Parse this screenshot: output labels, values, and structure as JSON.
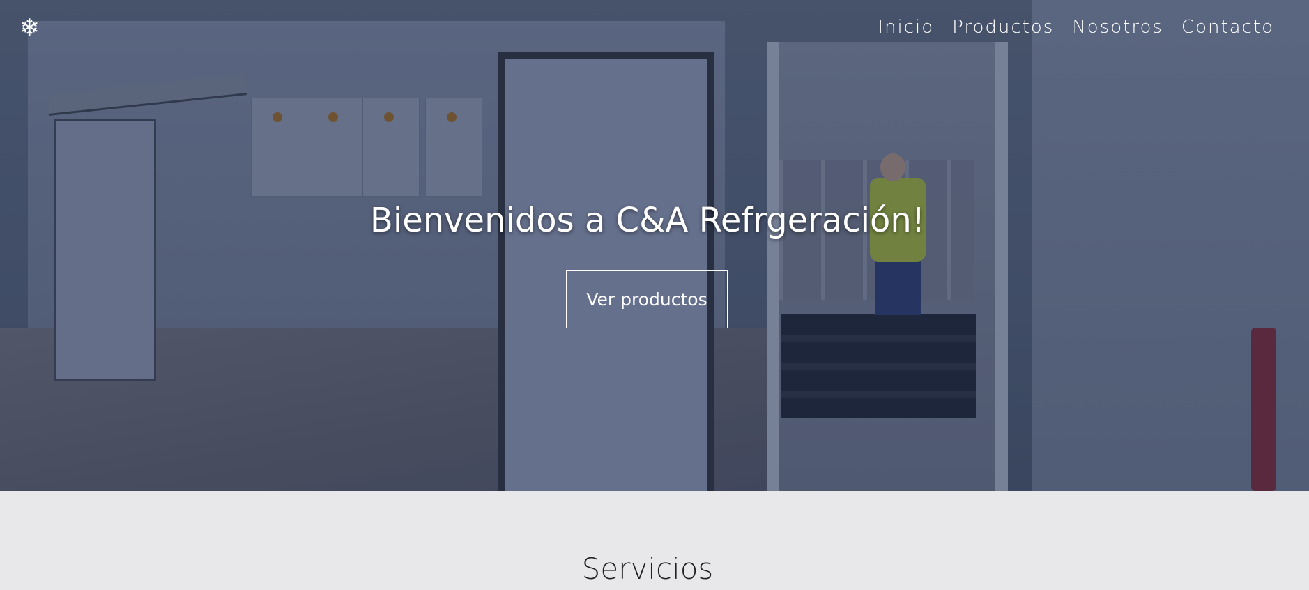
{
  "header": {
    "logo_icon": "❄",
    "nav": [
      {
        "label": "Inicio"
      },
      {
        "label": "Productos"
      },
      {
        "label": "Nosotros"
      },
      {
        "label": "Contacto"
      }
    ]
  },
  "hero": {
    "title": "Bienvenidos a C&A Refrgeración!",
    "button_label": "Ver productos"
  },
  "servicios": {
    "title": "Servicios"
  },
  "colors": {
    "section_bg": "#e8e8eb",
    "text_light": "#ffffff",
    "text_dark": "#222222"
  }
}
